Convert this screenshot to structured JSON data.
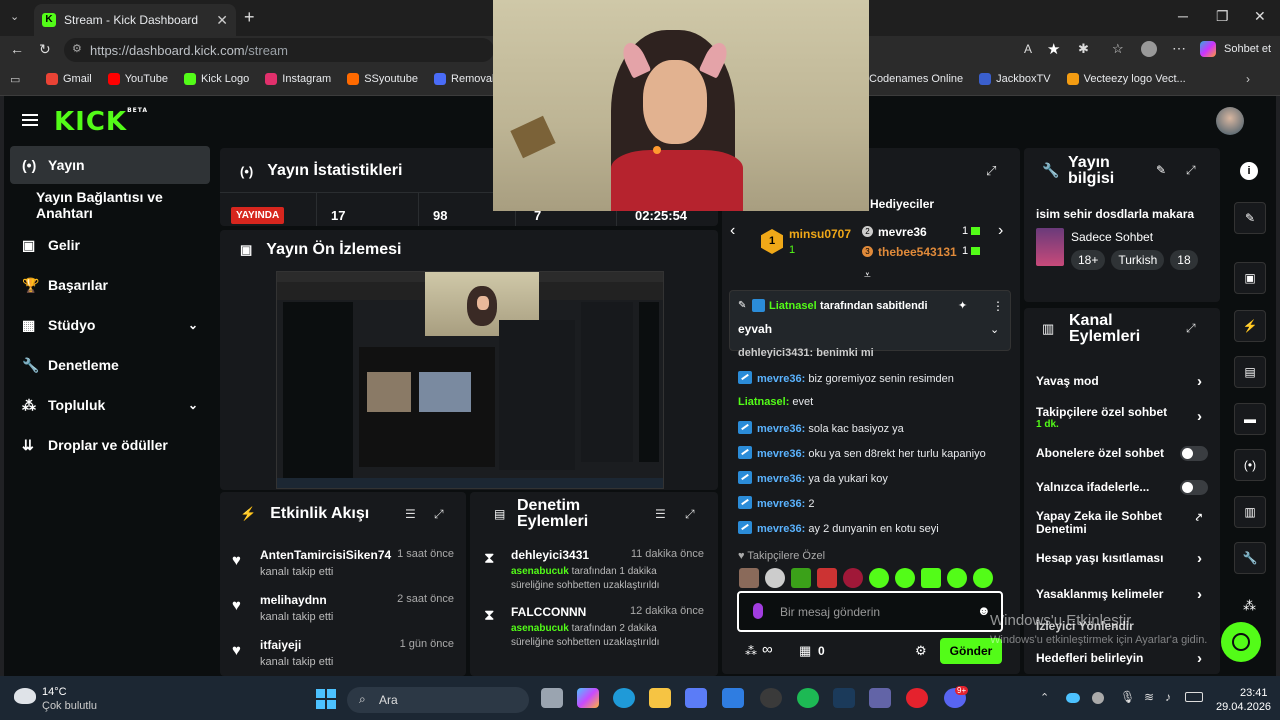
{
  "browser": {
    "tab_title": "Stream - Kick Dashboard",
    "url_host": "https://dashboard.kick.com",
    "url_path": "/stream",
    "copilot": "Sohbet et"
  },
  "bookmarks": [
    {
      "label": "Gmail",
      "color": "#ea4335"
    },
    {
      "label": "YouTube",
      "color": "#ff0000"
    },
    {
      "label": "Kick Logo",
      "color": "#53fc18"
    },
    {
      "label": "Instagram",
      "color": "#e1306c"
    },
    {
      "label": "SSyoutube",
      "color": "#ff6a00"
    },
    {
      "label": "Removal.AI",
      "color": "#4a6cf7"
    },
    {
      "label": "Codenames Online",
      "color": "#c0392b"
    },
    {
      "label": "JackboxTV",
      "color": "#3a5fcd"
    },
    {
      "label": "Vecteezy logo Vect...",
      "color": "#f39c12"
    }
  ],
  "app": {
    "logo": "KICK",
    "logo_sup": "BETA",
    "accent": "#53fc18"
  },
  "sidebar": [
    {
      "label": "Yayın",
      "icon": "broadcast-icon"
    },
    {
      "label": "Yayın Bağlantısı ve Anahtarı",
      "icon": ""
    },
    {
      "label": "Gelir",
      "icon": "wallet-icon"
    },
    {
      "label": "Başarılar",
      "icon": "trophy-icon"
    },
    {
      "label": "Stüdyo",
      "icon": "grid-icon"
    },
    {
      "label": "Denetleme",
      "icon": "wrench-icon"
    },
    {
      "label": "Topluluk",
      "icon": "community-icon"
    },
    {
      "label": "Droplar ve ödüller",
      "icon": "drop-icon"
    }
  ],
  "stats": {
    "title": "Yayın İstatistikleri",
    "live": "YAYINDA",
    "v1": "17",
    "v2": "98",
    "v3": "7",
    "v4": "02:25:54"
  },
  "preview": {
    "title": "Yayın Ön İzlemesi"
  },
  "activity": {
    "title": "Etkinlik Akışı",
    "items": [
      {
        "name": "AntenTamircisiSiken74",
        "time": "1 saat önce",
        "action": "kanalı takip etti"
      },
      {
        "name": "melihaydnn",
        "time": "2 saat önce",
        "action": "kanalı takip etti"
      },
      {
        "name": "itfaiyeji",
        "time": "1 gün önce",
        "action": "kanalı takip etti"
      }
    ]
  },
  "modlog": {
    "title_l1": "Denetim",
    "title_l2": "Eylemleri",
    "items": [
      {
        "name": "dehleyici3431",
        "time": "11 dakika önce",
        "mod": "asenabucuk",
        "desc": " tarafından 1 dakika süreliğine sohbetten uzaklaştırıldı"
      },
      {
        "name": "FALCCONNN",
        "time": "12 dakika önce",
        "mod": "asenabucuk",
        "desc": " tarafından 2 dakika süreliğine sohbetten uzaklaştırıldı"
      }
    ]
  },
  "chat": {
    "gifters_title": "Hediyeciler",
    "top": [
      {
        "rank": "1",
        "name": "minsu0707",
        "count": "1"
      },
      {
        "rank": "2",
        "name": "mevre36",
        "count": "1"
      },
      {
        "rank": "3",
        "name": "thebee543131",
        "count": "1"
      }
    ],
    "pinned_by": "Liatnasel",
    "pinned_suffix": " tarafından sabitlendi",
    "pinned_msg": "eyvah",
    "partial": "dehleyici3431: benimki mi",
    "messages": [
      {
        "user": "mevre36",
        "text": "biz goremiyoz senin resimden",
        "badge": true
      },
      {
        "user": "Liatnasel",
        "text": "evet",
        "badge": false
      },
      {
        "user": "mevre36",
        "text": "sola kac basiyoz ya",
        "badge": true
      },
      {
        "user": "mevre36",
        "text": "oku ya sen d8rekt her turlu kapaniyo",
        "badge": true
      },
      {
        "user": "mevre36",
        "text": "ya da yukari koy",
        "badge": true
      },
      {
        "user": "mevre36",
        "text": "2",
        "badge": true
      },
      {
        "user": "mevre36",
        "text": "ay 2 dunyanin en kotu seyi",
        "badge": true
      }
    ],
    "followers_only": "Takipçilere Özel",
    "placeholder": "Bir mesaj gönderin",
    "viewers": "∞",
    "coins": "0",
    "send": "Gönder"
  },
  "info": {
    "title_l1": "Yayın",
    "title_l2": "bilgisi",
    "stream_title": "isim sehir dosdlarla makara",
    "category": "Sadece Sohbet",
    "tags": [
      "18+",
      "Turkish",
      "18"
    ]
  },
  "channel": {
    "title_l1": "Kanal",
    "title_l2": "Eylemleri",
    "rows": [
      {
        "label": "Yavaş mod",
        "sub": "",
        "type": "chev"
      },
      {
        "label": "Takipçilere özel sohbet",
        "sub": "1 dk.",
        "type": "chev"
      },
      {
        "label": "Abonelere özel sohbet",
        "sub": "",
        "type": "toggle"
      },
      {
        "label": "Yalnızca ifadelerle...",
        "sub": "",
        "type": "toggle"
      },
      {
        "label": "Yapay Zeka ile Sohbet Denetimi",
        "sub": "",
        "type": "ext"
      },
      {
        "label": "Hesap yaşı kısıtlaması",
        "sub": "",
        "type": "chev"
      },
      {
        "label": "Yasaklanmış kelimeler",
        "sub": "",
        "type": "chev"
      },
      {
        "label": "İzleyici Yönlendir",
        "sub": "",
        "type": "none"
      },
      {
        "label": "Hedefleri belirleyin",
        "sub": "",
        "type": "chev"
      }
    ]
  },
  "watermark": {
    "l1": "Windows'u Etkinleştir",
    "l2": "Windows'u etkinleştirmek için Ayarlar'a gidin."
  },
  "taskbar": {
    "temp": "14°C",
    "weather": "Çok bulutlu",
    "search": "Ara",
    "time": "23:41",
    "date": "29.04.2026",
    "discord_badge": "9+"
  }
}
